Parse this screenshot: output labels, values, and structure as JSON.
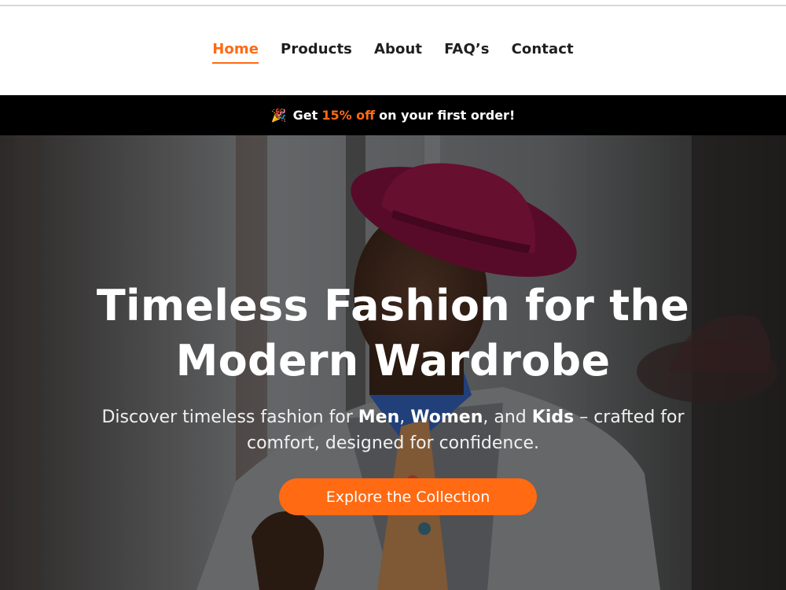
{
  "nav": {
    "items": [
      {
        "label": "Home",
        "active": true
      },
      {
        "label": "Products",
        "active": false
      },
      {
        "label": "About",
        "active": false
      },
      {
        "label": "FAQ’s",
        "active": false
      },
      {
        "label": "Contact",
        "active": false
      }
    ]
  },
  "promo": {
    "icon": "party-popper-icon",
    "prefix": "Get",
    "highlight": "15% off",
    "suffix": "on your first order!"
  },
  "hero": {
    "title_line1": "Timeless Fashion for the",
    "title_line2": "Modern Wardrobe",
    "subtitle_prefix": "Discover timeless fashion for",
    "subtitle_men": "Men",
    "subtitle_comma": ",",
    "subtitle_women": "Women",
    "subtitle_and": ", and",
    "subtitle_kids": "Kids",
    "subtitle_after": "– crafted for",
    "subtitle_line2": "comfort, designed for confidence.",
    "cta_label": "Explore the Collection"
  },
  "colors": {
    "accent": "#ff6a13",
    "promo_bg": "#000000",
    "nav_text": "#1f1f1f"
  }
}
